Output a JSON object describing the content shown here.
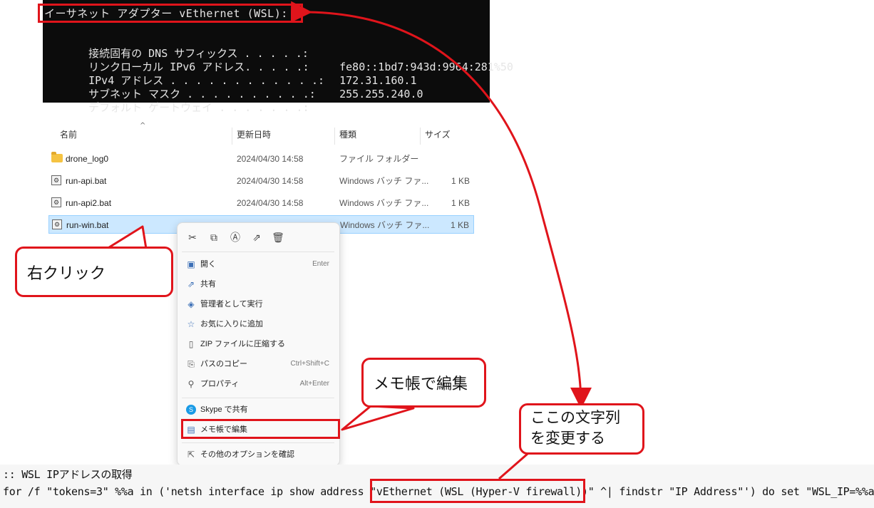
{
  "terminal": {
    "adapter_header": "イーサネット アダプター vEthernet (WSL):",
    "rows": [
      {
        "label": "接続固有の DNS サフィックス . . . . .:",
        "value": ""
      },
      {
        "label": "リンクローカル IPv6 アドレス. . . . .:",
        "value": "fe80::1bd7:943d:9964:281%50"
      },
      {
        "label": "IPv4 アドレス . . . . . . . . . . . .:",
        "value": "172.31.160.1"
      },
      {
        "label": "サブネット マスク . . . . . . . . . .:",
        "value": "255.255.240.0"
      },
      {
        "label": "デフォルト ゲートウェイ . . . . . . .:",
        "value": ""
      }
    ]
  },
  "explorer": {
    "columns": {
      "name": "名前",
      "date": "更新日時",
      "type": "種類",
      "size": "サイズ"
    },
    "sort_arrow": "^",
    "files": [
      {
        "name": "drone_log0",
        "date": "2024/04/30 14:58",
        "type": "ファイル フォルダー",
        "size": "",
        "icon": "folder-icon"
      },
      {
        "name": "run-api.bat",
        "date": "2024/04/30 14:58",
        "type": "Windows バッチ ファ...",
        "size": "1 KB",
        "icon": "batch-file-icon"
      },
      {
        "name": "run-api2.bat",
        "date": "2024/04/30 14:58",
        "type": "Windows バッチ ファ...",
        "size": "1 KB",
        "icon": "batch-file-icon"
      },
      {
        "name": "run-win.bat",
        "date": "",
        "type": "Windows バッチ ファ...",
        "size": "1 KB",
        "icon": "batch-file-icon"
      }
    ]
  },
  "context_menu": {
    "top_icons": [
      "cut-icon",
      "copy-icon",
      "rename-icon",
      "share-icon",
      "delete-icon"
    ],
    "items": [
      {
        "label": "開く",
        "shortcut": "Enter",
        "icon": "open-icon"
      },
      {
        "label": "共有",
        "shortcut": "",
        "icon": "share-icon"
      },
      {
        "label": "管理者として実行",
        "shortcut": "",
        "icon": "admin-shield-icon"
      },
      {
        "label": "お気に入りに追加",
        "shortcut": "",
        "icon": "star-icon"
      },
      {
        "label": "ZIP ファイルに圧縮する",
        "shortcut": "",
        "icon": "zip-icon"
      },
      {
        "label": "パスのコピー",
        "shortcut": "Ctrl+Shift+C",
        "icon": "path-copy-icon"
      },
      {
        "label": "プロパティ",
        "shortcut": "Alt+Enter",
        "icon": "properties-icon"
      },
      {
        "label": "Skype で共有",
        "shortcut": "",
        "icon": "skype-icon"
      },
      {
        "label": "メモ帳で編集",
        "shortcut": "",
        "icon": "notepad-icon"
      },
      {
        "label": "その他のオプションを確認",
        "shortcut": "",
        "icon": "more-options-icon"
      }
    ]
  },
  "callouts": {
    "right_click": "右クリック",
    "edit_notepad": "メモ帳で編集",
    "change_string": "ここの文字列\nを変更する"
  },
  "code": {
    "line1": ":: WSL IPアドレスの取得",
    "line2_prefix": "for /f \"tokens=3\" %%a in ('netsh interface ip show address \"",
    "line2_highlight": "vEthernet (WSL (Hyper-V firewall))",
    "line2_suffix": "\" ^| findstr \"IP Address\"') do set \"WSL_IP=%%a\""
  },
  "colors": {
    "accent_red": "#e0141b",
    "terminal_bg": "#0c0c0c",
    "selection": "#cce8ff"
  }
}
